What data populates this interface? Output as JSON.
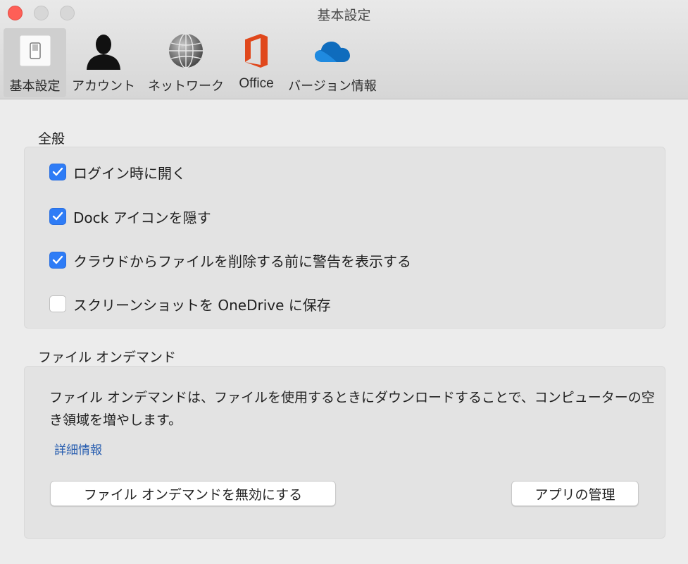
{
  "window": {
    "title": "基本設定",
    "traffic_lights": {
      "close_color": "#fe5f57",
      "inactive_color": "#d7d7d7"
    }
  },
  "toolbar": {
    "tabs": [
      {
        "label": "基本設定",
        "icon": "switch-icon",
        "selected": true
      },
      {
        "label": "アカウント",
        "icon": "person-silhouette-icon",
        "selected": false
      },
      {
        "label": "ネットワーク",
        "icon": "globe-network-icon",
        "selected": false
      },
      {
        "label": "Office",
        "icon": "office-logo-icon",
        "selected": false
      },
      {
        "label": "バージョン情報",
        "icon": "onedrive-cloud-icon",
        "selected": false
      }
    ]
  },
  "general": {
    "title": "全般",
    "options": [
      {
        "label": "ログイン時に開く",
        "checked": true
      },
      {
        "label": "Dock アイコンを隠す",
        "checked": true
      },
      {
        "label": "クラウドからファイルを削除する前に警告を表示する",
        "checked": true
      },
      {
        "label": "スクリーンショットを OneDrive に保存",
        "checked": false
      }
    ]
  },
  "files_on_demand": {
    "title": "ファイル オンデマンド",
    "description": "ファイル オンデマンドは、ファイルを使用するときにダウンロードすることで、コンピューターの空き領域を増やします。",
    "more_info_link": "詳細情報",
    "disable_button": "ファイル オンデマンドを無効にする",
    "manage_apps_button": "アプリの管理"
  },
  "colors": {
    "accent": "#2e7cf6",
    "link": "#2a5fb0",
    "office_orange": "#e0481c",
    "onedrive_blue": "#0f6cbd"
  }
}
